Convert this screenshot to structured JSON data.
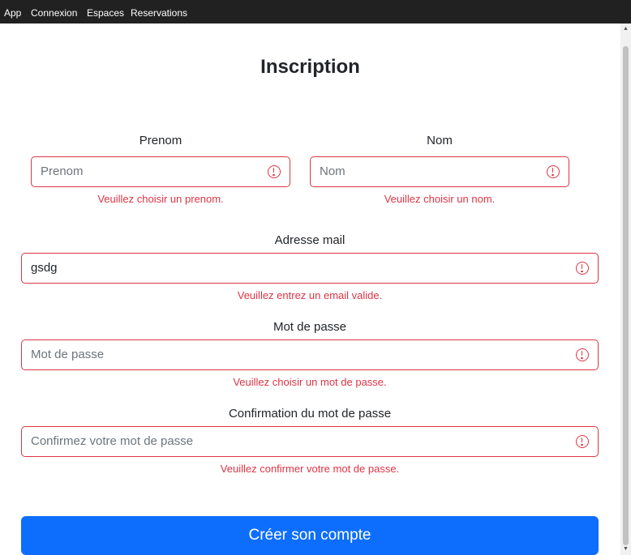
{
  "navbar": {
    "items": [
      {
        "label": "App"
      },
      {
        "label": "Connexion"
      },
      {
        "label": "Espaces"
      },
      {
        "label": "Reservations"
      }
    ]
  },
  "form": {
    "title": "Inscription",
    "prenom": {
      "label": "Prenom",
      "placeholder": "Prenom",
      "value": "",
      "error": "Veuillez choisir un prenom."
    },
    "nom": {
      "label": "Nom",
      "placeholder": "Nom",
      "value": "",
      "error": "Veuillez choisir un nom."
    },
    "email": {
      "label": "Adresse mail",
      "placeholder": "",
      "value": "gsdg",
      "error": "Veuillez entrez un email valide."
    },
    "password": {
      "label": "Mot de passe",
      "placeholder": "Mot de passe",
      "value": "",
      "error": "Veuillez choisir un mot de passe."
    },
    "confirm": {
      "label": "Confirmation du mot de passe",
      "placeholder": "Confirmez votre mot de passe",
      "value": "",
      "error": "Veuillez confirmer votre mot de passe."
    },
    "submit_label": "Créer son compte"
  },
  "colors": {
    "navbar_bg": "#212121",
    "invalid": "#dc3545",
    "primary_button": "#0d6efd"
  },
  "icons": {
    "invalid_indicator": "exclamation-circle-icon"
  }
}
